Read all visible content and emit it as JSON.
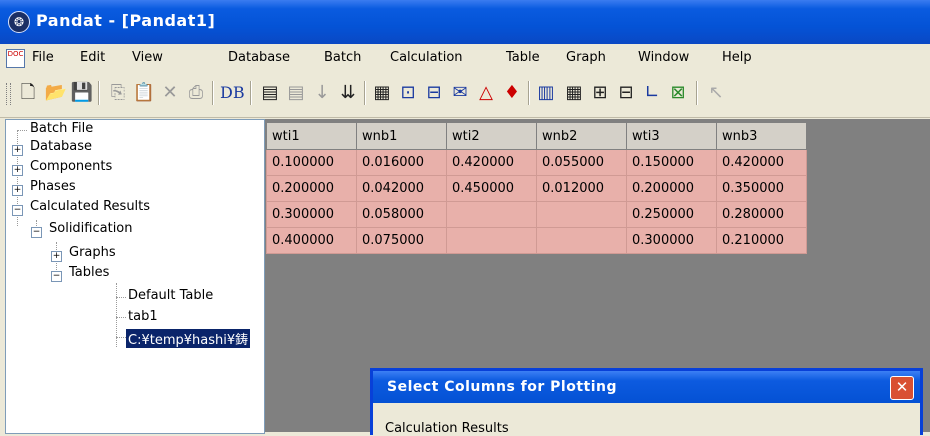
{
  "window": {
    "title": "Pandat - [Pandat1]"
  },
  "menu": [
    "File",
    "Edit",
    "View",
    "Database",
    "Batch",
    "Calculation",
    "Table",
    "Graph",
    "Window",
    "Help"
  ],
  "toolbar": {
    "db_label": "DB"
  },
  "tree": {
    "batch_file": "Batch File",
    "database": "Database",
    "components": "Components",
    "phases": "Phases",
    "calculated_results": "Calculated Results",
    "solidification": "Solidification",
    "graphs": "Graphs",
    "tables": "Tables",
    "default_table": "Default Table",
    "tab1": "tab1",
    "path_item": "C:¥temp¥hashi¥鋳"
  },
  "table": {
    "headers": [
      "wti1",
      "wnb1",
      "wti2",
      "wnb2",
      "wti3",
      "wnb3"
    ],
    "rows": [
      [
        "0.100000",
        "0.016000",
        "0.420000",
        "0.055000",
        "0.150000",
        "0.420000"
      ],
      [
        "0.200000",
        "0.042000",
        "0.450000",
        "0.012000",
        "0.200000",
        "0.350000"
      ],
      [
        "0.300000",
        "0.058000",
        "",
        "",
        "0.250000",
        "0.280000"
      ],
      [
        "0.400000",
        "0.075000",
        "",
        "",
        "0.300000",
        "0.210000"
      ]
    ]
  },
  "dialog": {
    "title": "Select Columns for Plotting",
    "partial_text": "Calculation Results"
  }
}
